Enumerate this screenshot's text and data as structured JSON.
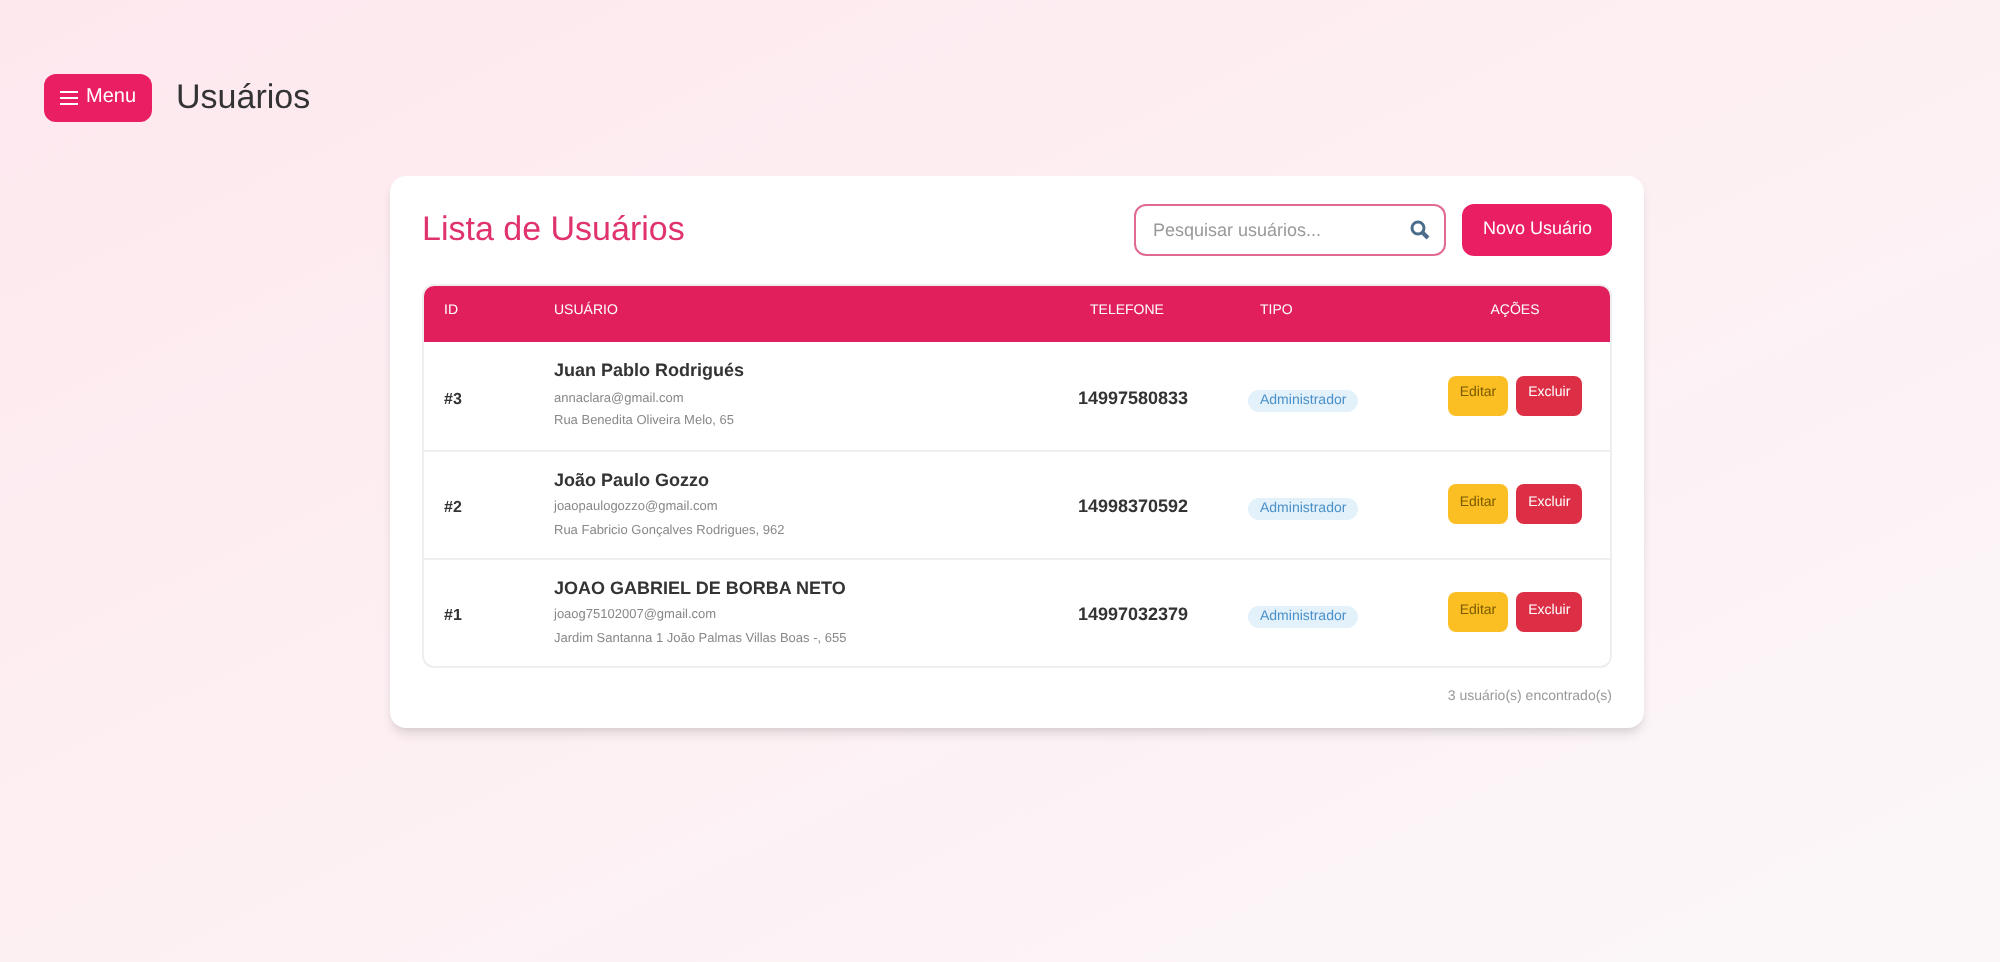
{
  "header": {
    "menu_button": "Menu",
    "title": "Usuários"
  },
  "card": {
    "title": "Lista de Usuários",
    "search": {
      "placeholder": "Pesquisar usuários..."
    },
    "new_button": "Novo Usuário"
  },
  "table": {
    "columns": [
      "ID",
      "USUÁRIO",
      "TELEFONE",
      "TIPO",
      "AÇÕES"
    ],
    "rows": [
      {
        "id": "#3",
        "name": "Juan Pablo Rodrigués",
        "email": "annaclara@gmail.com",
        "address": "Rua Benedita Oliveira Melo, 65",
        "phone": "14997580833",
        "type": "Administrador",
        "actions": [
          "Editar",
          "Excluir"
        ]
      },
      {
        "id": "#2",
        "name": "João Paulo Gozzo",
        "email": "joaopaulogozzo@gmail.com",
        "address": "Rua Fabricio Gonçalves Rodrigues, 962",
        "phone": "14998370592",
        "type": "Administrador",
        "actions": [
          "Editar",
          "Excluir"
        ]
      },
      {
        "id": "#1",
        "name": "JOAO GABRIEL DE BORBA NETO",
        "email": "joaog75102007@gmail.com",
        "address": "Jardim Santanna 1 João Palmas Villas Boas -, 655",
        "phone": "14997032379",
        "type": "Administrador",
        "actions": [
          "Editar",
          "Excluir"
        ]
      }
    ]
  },
  "footer": "3 usuário(s) encontrado(s)"
}
